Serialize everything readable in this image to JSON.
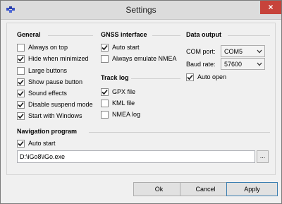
{
  "window": {
    "title": "Settings",
    "close_label": "×"
  },
  "general": {
    "title": "General",
    "items": [
      {
        "label": "Always on top",
        "checked": false
      },
      {
        "label": "Hide when minimized",
        "checked": true
      },
      {
        "label": "Large buttons",
        "checked": false
      },
      {
        "label": "Show pause button",
        "checked": true
      },
      {
        "label": "Sound effects",
        "checked": true
      },
      {
        "label": "Disable suspend mode",
        "checked": true
      },
      {
        "label": "Start with Windows",
        "checked": true
      }
    ]
  },
  "gnss": {
    "title": "GNSS interface",
    "items": [
      {
        "label": "Auto start",
        "checked": true
      },
      {
        "label": "Always emulate NMEA",
        "checked": false
      }
    ]
  },
  "track_log": {
    "title": "Track log",
    "items": [
      {
        "label": "GPX file",
        "checked": true
      },
      {
        "label": "KML file",
        "checked": false
      },
      {
        "label": "NMEA log",
        "checked": false
      }
    ]
  },
  "data_output": {
    "title": "Data output",
    "com_port_label": "COM port:",
    "com_port_value": "COM5",
    "baud_rate_label": "Baud rate:",
    "baud_rate_value": "57600",
    "auto_open": {
      "label": "Auto open",
      "checked": true
    }
  },
  "navigation": {
    "title": "Navigation program",
    "auto_start": {
      "label": "Auto start",
      "checked": true
    },
    "path": "D:\\iGo8\\iGo.exe",
    "browse_label": "..."
  },
  "buttons": {
    "ok": "Ok",
    "cancel": "Cancel",
    "apply": "Apply"
  },
  "colors": {
    "close": "#c7433b",
    "check": "#1a1a1a",
    "accent": "#3c7fb1"
  }
}
